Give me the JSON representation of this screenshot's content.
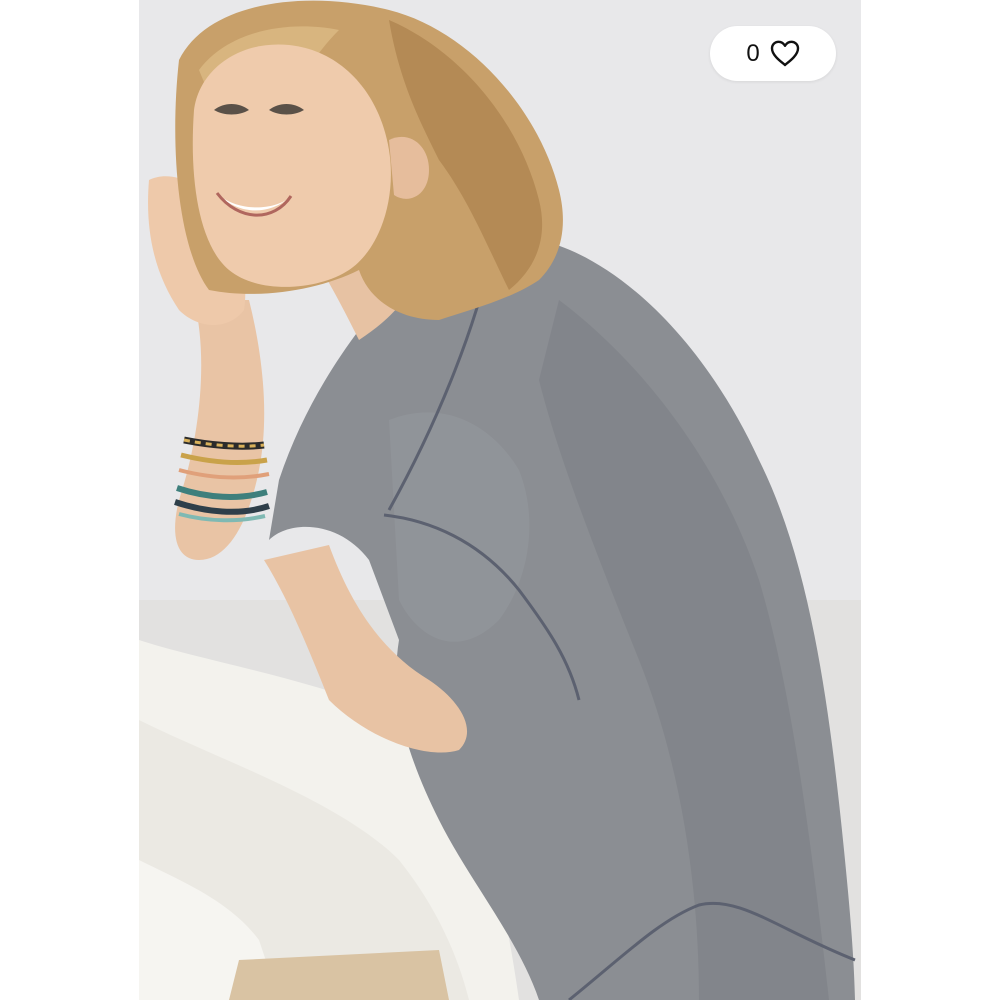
{
  "product_image": {
    "alt": ""
  },
  "favorite": {
    "count": "0",
    "icon": "heart-outline-icon"
  },
  "colors": {
    "page_background": "#ffffff",
    "photo_background": "#e9e9ea",
    "garment_grey": "#8a8d91",
    "pants_white": "#f2f1ec",
    "pill_background": "#ffffff",
    "text": "#111111"
  }
}
